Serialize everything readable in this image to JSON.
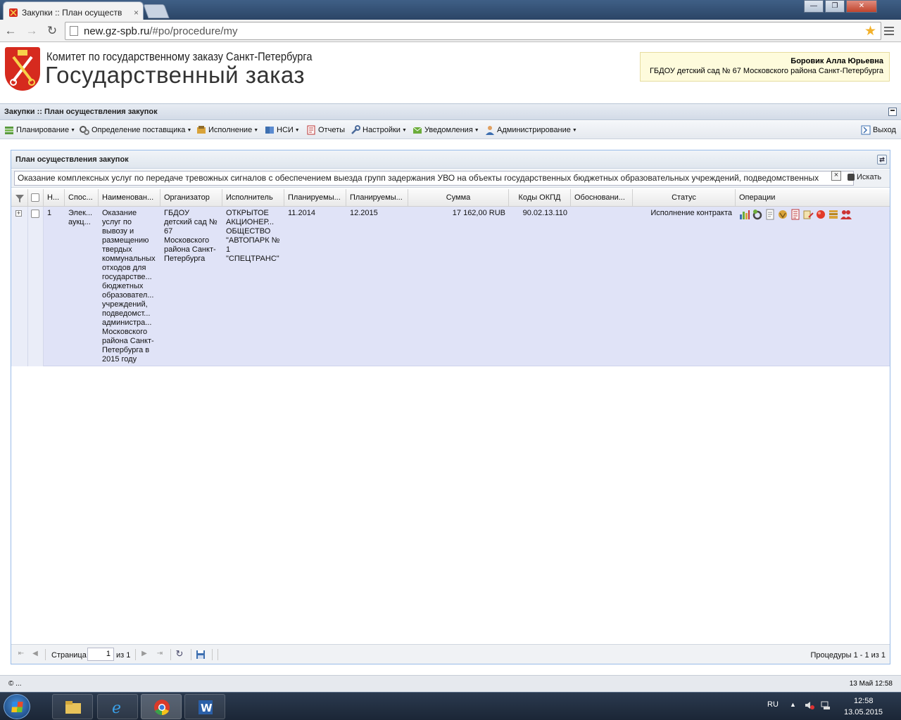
{
  "browser": {
    "tab_title": "Закупки :: План осуществ",
    "tab_close": "×",
    "url_host": "new.gz-spb.ru",
    "url_path": "/#po/procedure/my",
    "window_controls": [
      "—",
      "❐",
      "✕"
    ]
  },
  "site": {
    "org_line": "Комитет по государственному заказу Санкт-Петербурга",
    "brand": "Государственный заказ",
    "user_name": "Боровик Алла Юрьевна",
    "user_org": "ГБДОУ детский сад № 67 Московского района Санкт-Петербурга"
  },
  "app": {
    "title": "Закупки :: План осуществления закупок",
    "menu": [
      {
        "label": "Планирование",
        "icon": "planning-icon"
      },
      {
        "label": "Определение поставщика",
        "icon": "gears-icon"
      },
      {
        "label": "Исполнение",
        "icon": "execution-icon"
      },
      {
        "label": "НСИ",
        "icon": "book-icon"
      },
      {
        "label": "Отчеты",
        "icon": "report-icon"
      },
      {
        "label": "Настройки",
        "icon": "wrench-icon"
      },
      {
        "label": "Уведомления",
        "icon": "notification-icon"
      },
      {
        "label": "Администрирование",
        "icon": "user-icon"
      }
    ],
    "logout": "Выход"
  },
  "panel": {
    "title": "План осуществления закупок",
    "search_value": "Оказание комплексных услуг по передаче тревожных сигналов с обеспечением выезда групп задержания УВО на объекты государственных бюджетных образовательных учреждений, подведомственных",
    "search_clear": "×",
    "search_button": "Искать"
  },
  "grid": {
    "columns": [
      "Н...",
      "Спос...",
      "Наименован...",
      "Организатор",
      "Исполнитель",
      "Планируемы...",
      "Планируемы...",
      "Сумма",
      "Коды ОКПД",
      "Обосновани...",
      "Статус",
      "Операции"
    ],
    "rows": [
      {
        "expander": "+",
        "num": "1",
        "method": "Элек... аукц...",
        "name": "Оказание услуг по вывозу и размещению твердых коммунальных отходов для государстве... бюджетных образовател... учреждений, подведомст... администра... Московского района Санкт-Петербурга в 2015 году",
        "organizer": "ГБДОУ детский сад № 67 Московского района Санкт-Петербурга",
        "executor": "ОТКРЫТОЕ АКЦИОНЕР... ОБЩЕСТВО \"АВТОПАРК № 1 \"СПЕЦТРАНС\"",
        "plan_start": "11.2014",
        "plan_end": "12.2015",
        "amount": "17 162,00 RUB",
        "okpd": "90.02.13.110",
        "justification": "",
        "status": "Исполнение контракта",
        "operations": [
          "chart-icon",
          "refresh-gear-icon",
          "document-icon",
          "emblem-icon",
          "list-document-icon",
          "scroll-edit-icon",
          "red-circle-icon",
          "stack-icon",
          "users-icon"
        ]
      }
    ]
  },
  "paging": {
    "page_label": "Страница",
    "page_value": "1",
    "of_label": "из 1",
    "info": "Процедуры 1 - 1 из 1"
  },
  "footer": {
    "copyright": "© ...",
    "datetime": "13 Май 12:58"
  },
  "taskbar": {
    "lang": "RU",
    "time": "12:58",
    "date": "13.05.2015"
  }
}
